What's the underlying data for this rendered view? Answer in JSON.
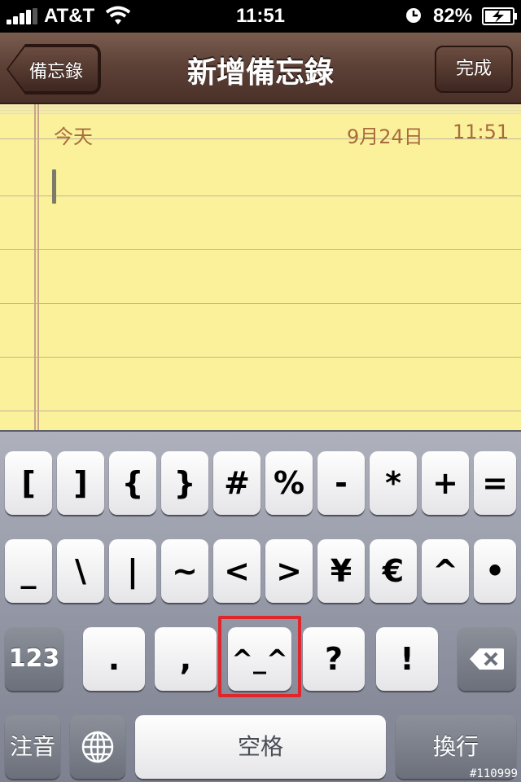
{
  "status_bar": {
    "carrier": "AT&T",
    "time": "11:51",
    "battery": "82%"
  },
  "nav": {
    "title": "新增備忘錄",
    "back_label": "備忘錄",
    "done_label": "完成"
  },
  "note": {
    "day": "今天",
    "date": "9月24日",
    "time": "11:51"
  },
  "keyboard": {
    "row1": [
      "[",
      "]",
      "{",
      "}",
      "#",
      "%",
      "-",
      "*",
      "+",
      "="
    ],
    "row2": [
      "_",
      "\\",
      "|",
      "~",
      "<",
      ">",
      "¥",
      "€",
      "^",
      "•"
    ],
    "row3": {
      "numbers_label": "123",
      "keys": [
        ".",
        ",",
        "^_^",
        "?",
        "!"
      ]
    },
    "row4": {
      "zhuyin_label": "注音",
      "space_label": "空格",
      "return_label": "換行"
    }
  },
  "watermark": "#110999"
}
